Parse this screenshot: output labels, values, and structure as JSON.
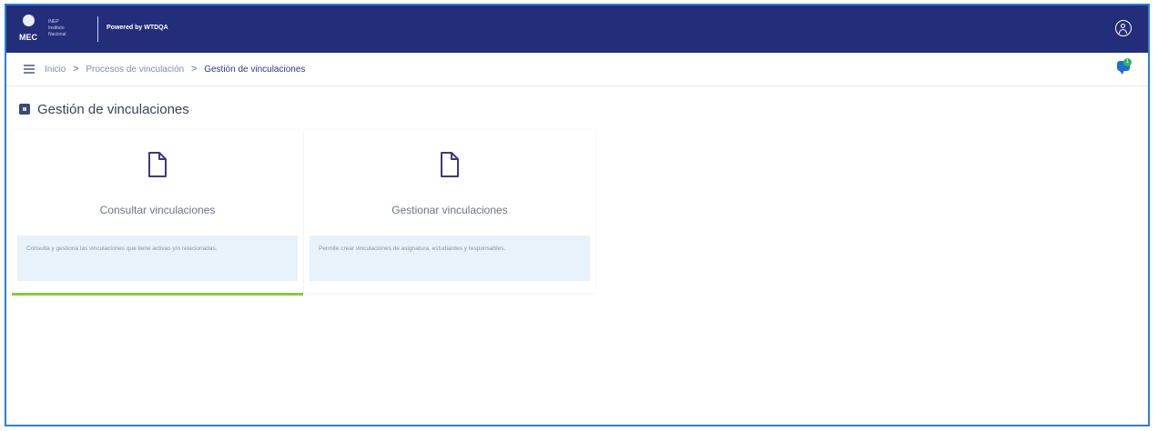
{
  "header": {
    "logo_text": "MEC",
    "logo_lines": [
      "INEP",
      "Instituto",
      "Nacional"
    ],
    "provider_text": "Powered by WTDQA",
    "user_icon": "user-circle-icon"
  },
  "breadcrumb": {
    "menu_icon": "hamburger-icon",
    "items": [
      "Inicio",
      "Procesos de vinculación",
      "Gestión de vinculaciones"
    ],
    "chat_icon": "chat-bubble-icon",
    "chat_badge": "1"
  },
  "page": {
    "title": "Gestión de vinculaciones"
  },
  "cards": [
    {
      "icon": "document-icon",
      "label": "Consultar vinculaciones",
      "description": "Consulta y gestiona las vinculaciones que tiene activas y/o relacionadas.",
      "active": true
    },
    {
      "icon": "document-icon",
      "label": "Gestionar vinculaciones",
      "description": "Permite crear vinculaciones de asignatura, estudiantes y responsables.",
      "active": false
    }
  ],
  "colors": {
    "topbar": "#232d7a",
    "accent": "#8cc63f",
    "desc_bg": "#e7f2fb",
    "frame": "#2a7fd4"
  }
}
